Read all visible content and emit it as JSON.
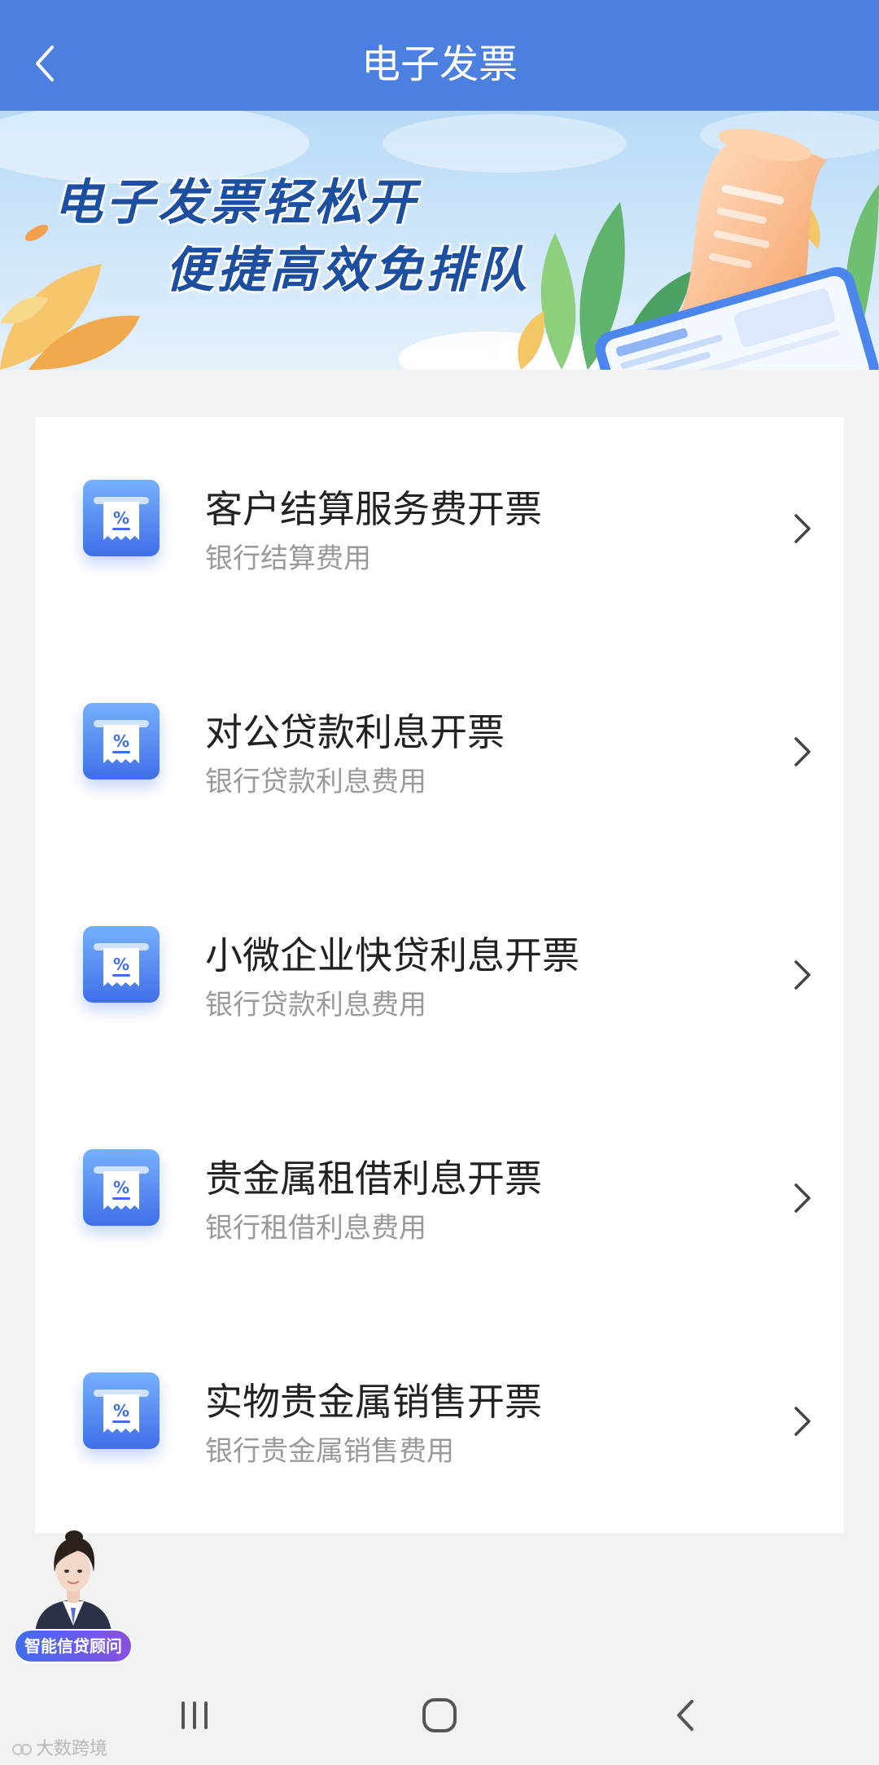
{
  "header": {
    "title": "电子发票",
    "back_icon": "chevron-left-icon"
  },
  "banner": {
    "line1": "电子发票轻松开",
    "line2": "便捷高效免排队"
  },
  "service_icon": {
    "name": "invoice-percent-icon",
    "glyph": "%"
  },
  "services": [
    {
      "title": "客户结算服务费开票",
      "subtitle": "银行结算费用"
    },
    {
      "title": "对公贷款利息开票",
      "subtitle": "银行贷款利息费用"
    },
    {
      "title": "小微企业快贷利息开票",
      "subtitle": "银行贷款利息费用"
    },
    {
      "title": "贵金属租借利息开票",
      "subtitle": "银行租借利息费用"
    },
    {
      "title": "实物贵金属销售开票",
      "subtitle": "银行贵金属销售费用"
    }
  ],
  "assistant": {
    "label": "智能信贷顾问"
  },
  "nav": {
    "recent_icon": "recent-apps-icon",
    "home_icon": "home-icon",
    "back_icon": "back-icon"
  },
  "watermark": "大数跨境",
  "colors": {
    "header": "#4b7fe0",
    "banner_text": "#1d4fa0",
    "page_bg": "#f2f2f2",
    "card_bg": "#ffffff",
    "title_text": "#222222",
    "subtitle_text": "#9a9a9a",
    "icon_blue": "#3e6fe9"
  }
}
